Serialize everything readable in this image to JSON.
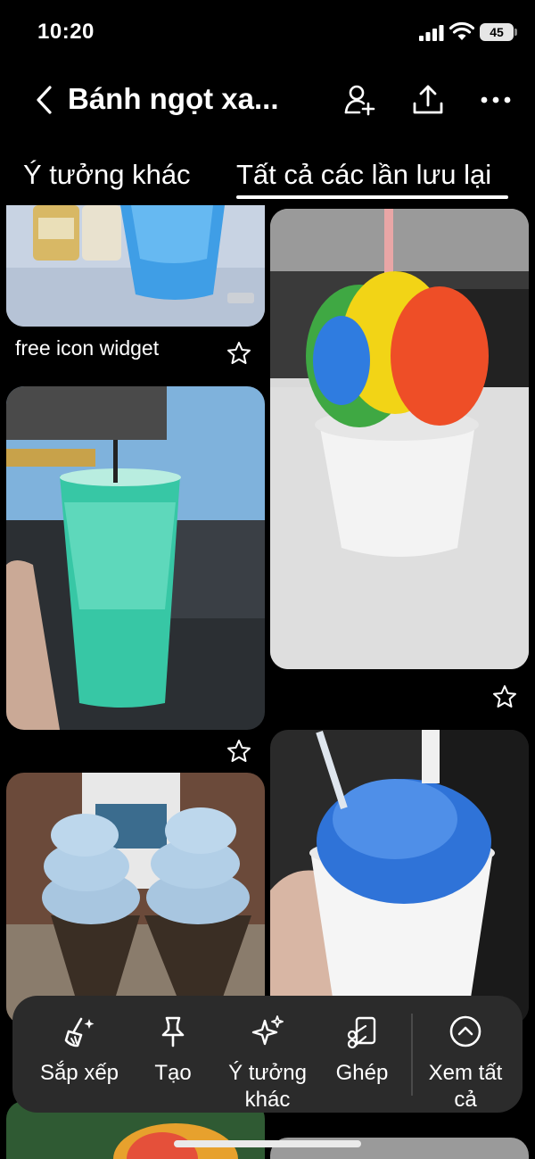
{
  "status_bar": {
    "time": "10:20",
    "battery": "45"
  },
  "header": {
    "title": "Bánh ngọt xa...",
    "icons": [
      "back-chevron-icon",
      "add-collaborator-icon",
      "share-icon",
      "more-icon"
    ]
  },
  "tabs": [
    {
      "label": "Ý tưởng khác",
      "selected": false
    },
    {
      "label": "Tất cả các lần lưu lại",
      "selected": true
    }
  ],
  "pins": [
    {
      "caption": "free icon widget"
    }
  ],
  "actions": [
    {
      "label": "Sắp xếp",
      "icon": "broom-sparkle-icon"
    },
    {
      "label": "Tạo",
      "icon": "pushpin-icon"
    },
    {
      "label": "Ý tưởng khác",
      "icon": "sparkles-icon"
    },
    {
      "label": "Ghép",
      "icon": "scissors-collage-icon"
    },
    {
      "label": "Xem tất cả",
      "icon": "chevron-up-circle-icon"
    }
  ],
  "colors": {
    "background": "#000000",
    "action_bar": "#2b2b2b",
    "text": "#ffffff"
  }
}
